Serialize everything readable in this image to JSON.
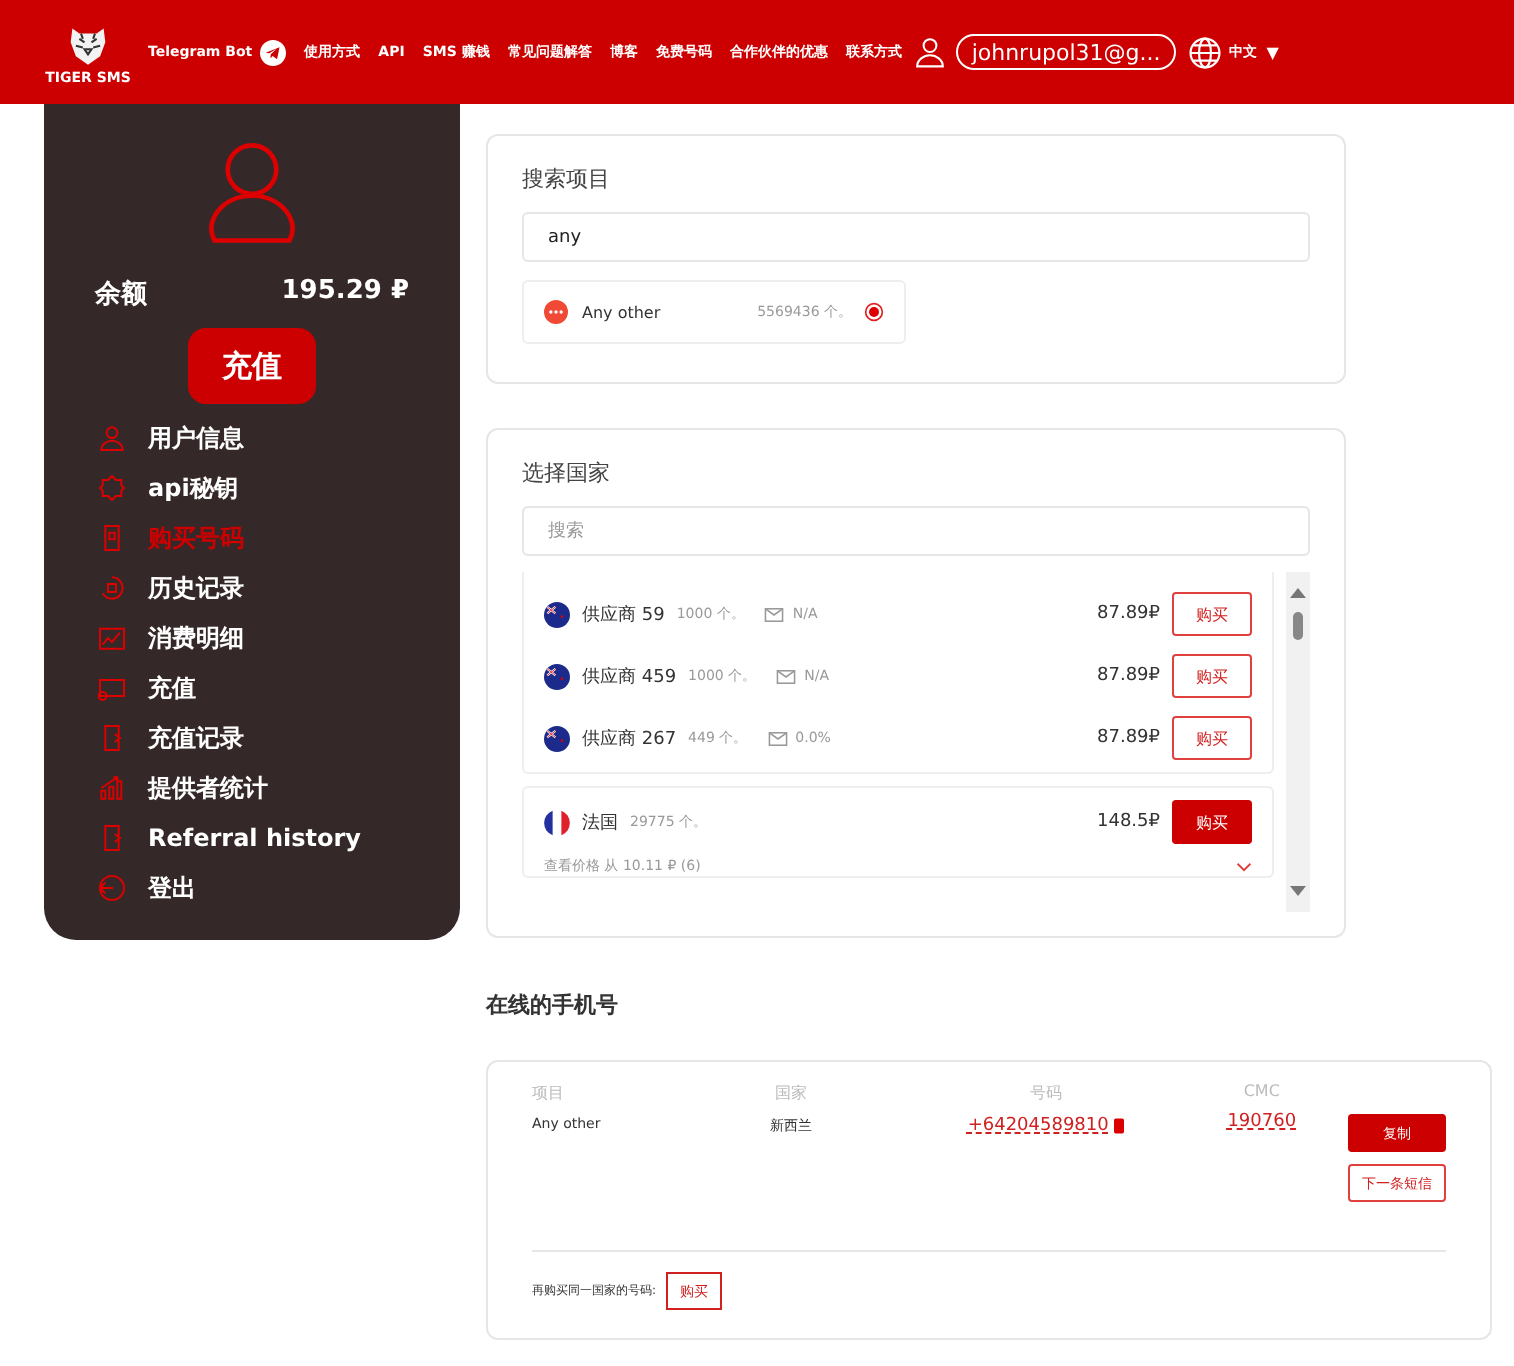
{
  "header": {
    "brand": "TIGER SMS",
    "nav": [
      {
        "label": "Telegram Bot",
        "kind": "telegram"
      },
      {
        "label": "使用方式",
        "kind": "plain"
      },
      {
        "label": "API",
        "kind": "plain"
      },
      {
        "label": "SMS 赚钱",
        "kind": "plain"
      },
      {
        "label": "常见问题解答",
        "kind": "plain"
      },
      {
        "label": "博客",
        "kind": "plain"
      },
      {
        "label": "免费号码",
        "kind": "plain"
      },
      {
        "label": "合作伙伴的优惠",
        "kind": "plain"
      },
      {
        "label": "联系方式",
        "kind": "plain"
      }
    ],
    "account": "johnrupol31@g...",
    "language": "中文",
    "caret": "▼"
  },
  "sidebar": {
    "balance_label": "余额",
    "balance": "195.29 ₽",
    "topup_button": "充值",
    "items": [
      {
        "label": "用户信息",
        "selected": false
      },
      {
        "label": "api秘钥",
        "selected": false
      },
      {
        "label": "购买号码",
        "selected": true
      },
      {
        "label": "历史记录",
        "selected": false
      },
      {
        "label": "消费明细",
        "selected": false
      },
      {
        "label": "充值",
        "selected": false
      },
      {
        "label": "充值记录",
        "selected": false
      },
      {
        "label": "提供者统计",
        "selected": false
      },
      {
        "label": "Referral history",
        "selected": false
      },
      {
        "label": "登出",
        "selected": false
      }
    ]
  },
  "service_search": {
    "title": "搜索项目",
    "value": "any",
    "results": [
      {
        "name": "Any other",
        "count": "5569436 个。",
        "selected": true
      }
    ]
  },
  "country_select": {
    "title": "选择国家",
    "placeholder": "搜索",
    "providers": [
      {
        "kind": "nz",
        "name": "供应商 59",
        "count": "1000 个。",
        "rate": "N/A",
        "price": "87.89₽",
        "button": "购买"
      },
      {
        "kind": "nz",
        "name": "供应商 459",
        "count": "1000 个。",
        "rate": "N/A",
        "price": "87.89₽",
        "button": "购买"
      },
      {
        "kind": "nz",
        "name": "供应商 267",
        "count": "449 个。",
        "rate": "0.0%",
        "price": "87.89₽",
        "button": "购买"
      }
    ],
    "countries": [
      {
        "kind": "fr",
        "name": "法国",
        "count": "29775 个。",
        "price": "148.5₽",
        "button": "购买",
        "prices_note": "查看价格 从 10.11 ₽ (6)"
      }
    ]
  },
  "online_numbers": {
    "title": "在线的手机号",
    "columns": [
      "项目",
      "国家",
      "号码",
      "CMC"
    ],
    "rows": [
      {
        "service": "Any other",
        "country": "新西兰",
        "number": "+64204589810",
        "code": "190760",
        "copy_button": "复制",
        "next_button": "下一条短信"
      }
    ],
    "rebuy_label": "再购买同一国家的号码:",
    "rebuy_button": "购买"
  }
}
